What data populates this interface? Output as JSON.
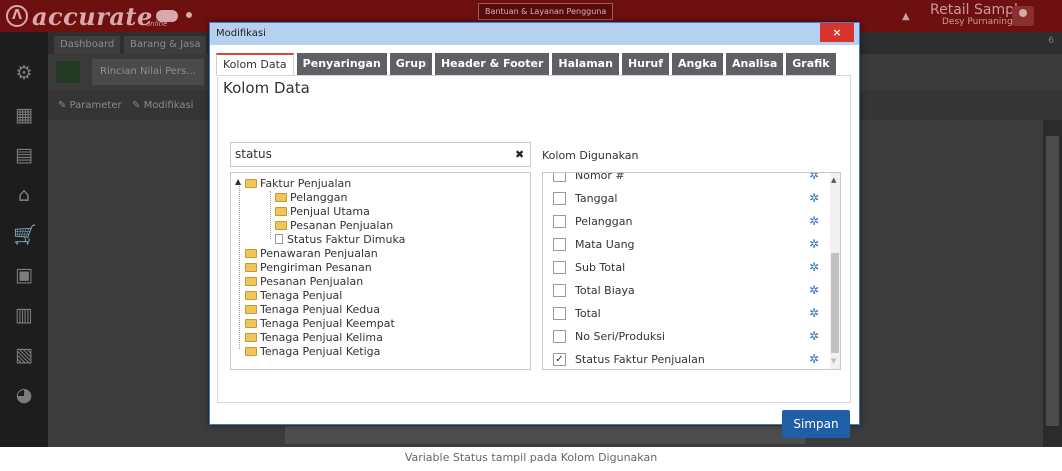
{
  "app": {
    "brand": "accurate",
    "brand_sub": "online",
    "help_label": "Bantuan & Layanan Pengguna",
    "company": "Retail Sample",
    "user": "Desy Purnaningrat"
  },
  "background": {
    "tabs": [
      "Dashboard",
      "Barang & Jasa"
    ],
    "tab_count": "6",
    "panel_title": "Rincian Nilai Pers...",
    "toolbar": [
      "Parameter",
      "Modifikasi"
    ]
  },
  "modal": {
    "title": "Modifikasi",
    "close_label": "×",
    "tabs": [
      "Kolom Data",
      "Penyaringan",
      "Grup",
      "Header & Footer",
      "Halaman",
      "Huruf",
      "Angka",
      "Analisa",
      "Grafik"
    ],
    "active_tab": "Kolom Data",
    "section_title": "Kolom Data",
    "search_value": "status",
    "tree": {
      "root": "Faktur Penjualan",
      "children": [
        "Pelanggan",
        "Penjual Utama",
        "Pesanan Penjualan",
        "Status Faktur Dimuka"
      ],
      "others": [
        "Penawaran Penjualan",
        "Pengiriman Pesanan",
        "Pesanan Penjualan",
        "Tenaga Penjual",
        "Tenaga Penjual Kedua",
        "Tenaga Penjual Keempat",
        "Tenaga Penjual Kelima",
        "Tenaga Penjual Ketiga"
      ]
    },
    "used_title": "Kolom Digunakan",
    "used_columns": [
      {
        "label": "Nomor #",
        "checked": false
      },
      {
        "label": "Tanggal",
        "checked": false
      },
      {
        "label": "Pelanggan",
        "checked": false
      },
      {
        "label": "Mata Uang",
        "checked": false
      },
      {
        "label": "Sub Total",
        "checked": false
      },
      {
        "label": "Total Biaya",
        "checked": false
      },
      {
        "label": "Total",
        "checked": false
      },
      {
        "label": "No Seri/Produksi",
        "checked": false
      },
      {
        "label": "Status Faktur Penjualan",
        "checked": true
      }
    ],
    "save_label": "Simpan"
  },
  "caption": "Variable Status tampil pada Kolom Digunakan",
  "colors": {
    "topbar": "#6e0f10",
    "accent_tab": "#d34a3d",
    "tab_inactive": "#5e6066",
    "save": "#1f5fa8",
    "close": "#d9342b",
    "gear": "#2f72c0"
  }
}
